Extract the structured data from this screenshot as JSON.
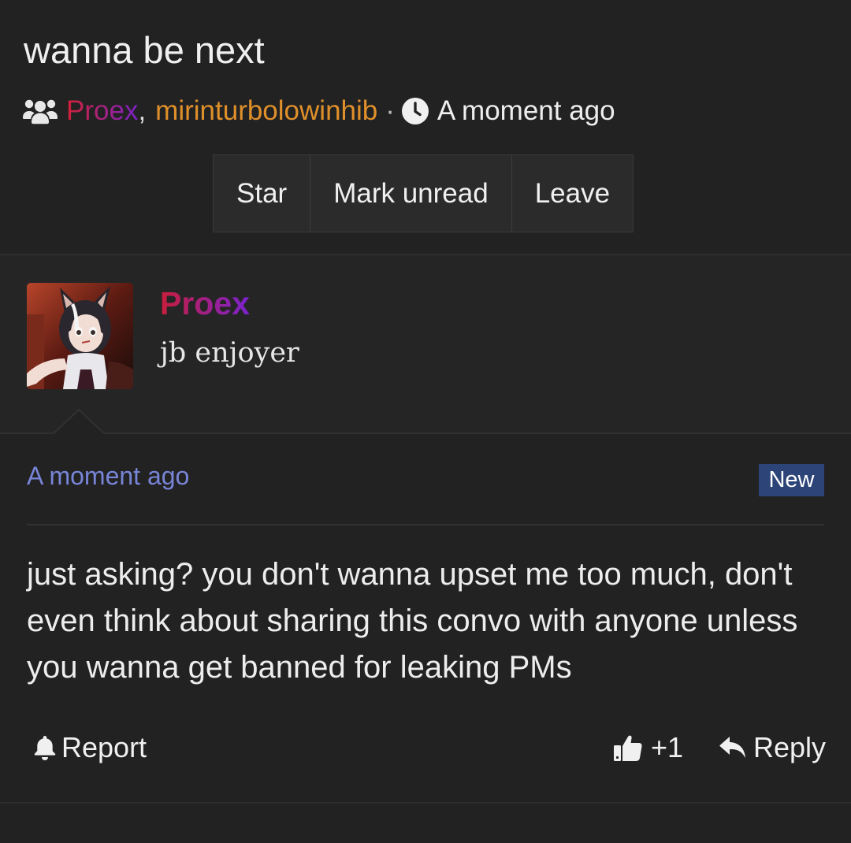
{
  "conversation": {
    "title": "wanna be next",
    "participants_icon": "users-icon",
    "participants": [
      {
        "name": "Proex",
        "color_from": "#d12236",
        "color_to": "#7d22c8"
      },
      {
        "name": "mirinturbolowinhib",
        "color": "#e0902a"
      }
    ],
    "participant_separator": ",",
    "dot": "·",
    "time_icon": "clock-icon",
    "time": "A moment ago"
  },
  "actions": {
    "star": "Star",
    "mark_unread": "Mark unread",
    "leave": "Leave"
  },
  "message": {
    "author": {
      "name": "Proex",
      "user_title": "jb enjoyer",
      "avatar": "anime-catgirl-avatar"
    },
    "timestamp": "A moment ago",
    "badge": "New",
    "body": "just asking? you don't wanna upset me too much, don't even think about sharing this convo with anyone unless you wanna get banned for leaking PMs",
    "footer": {
      "report_icon": "bell-icon",
      "report": "Report",
      "like_icon": "thumbs-up-icon",
      "like": "+1",
      "reply_icon": "reply-icon",
      "reply": "Reply"
    }
  },
  "colors": {
    "background": "#222223",
    "author_band": "#252526",
    "link_blue": "#7885d6",
    "badge_bg": "#2d4478",
    "participant_orange": "#e0902a"
  }
}
